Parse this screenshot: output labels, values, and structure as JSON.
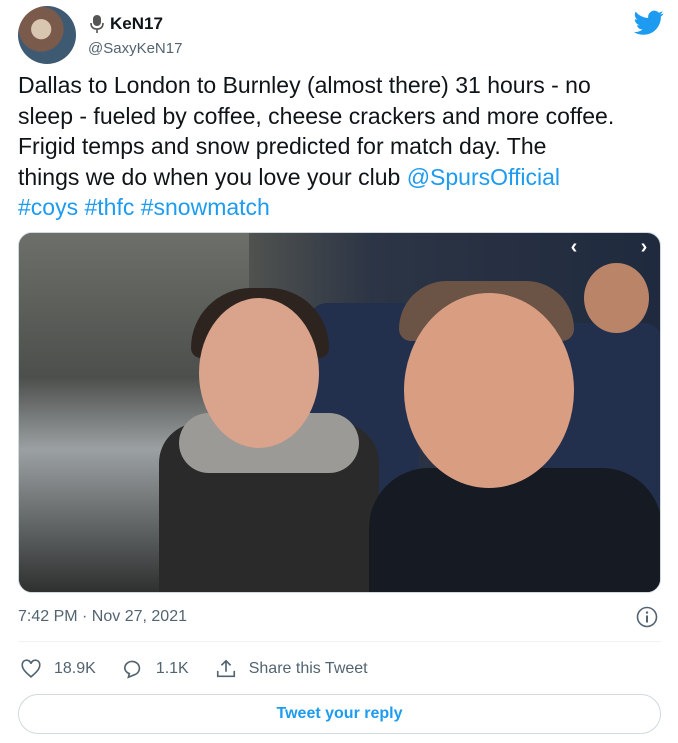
{
  "user": {
    "display_name": "KeN17",
    "handle": "@SaxyKeN17",
    "avatar_icon": "avatar-photo",
    "badge_icon": "microphone-icon"
  },
  "tweet": {
    "text_lines": [
      "Dallas to London to Burnley (almost there) 31 hours - no",
      "sleep - fueled by coffee, cheese crackers and more coffee.",
      "Frigid temps and snow predicted for match day. The",
      "things we do when you love your club "
    ],
    "mention": "@SpursOfficial",
    "hashtags": "#coys #thfc #snowmatch",
    "timestamp": "7:42 PM · Nov 27, 2021"
  },
  "actions": {
    "likes": "18.9K",
    "replies": "1.1K",
    "share_label": "Share this Tweet"
  },
  "reply_button": "Tweet your reply",
  "colors": {
    "accent": "#1d9bf0",
    "muted": "#536471",
    "text": "#0f1419"
  }
}
